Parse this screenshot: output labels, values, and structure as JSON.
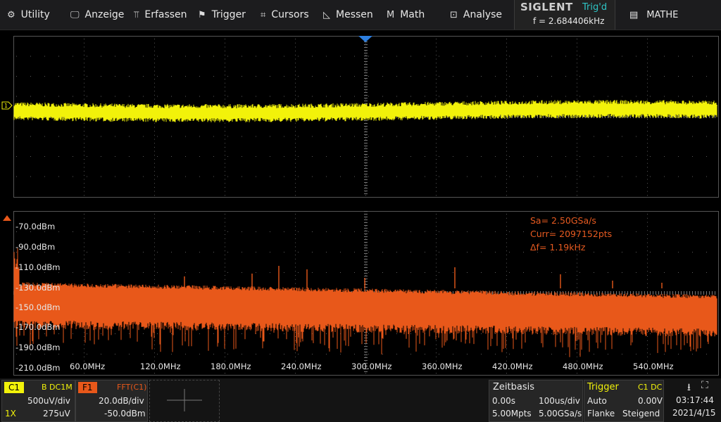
{
  "menu": {
    "items": [
      {
        "label": "Utility",
        "icon": "gear-icon"
      },
      {
        "label": "Anzeige",
        "icon": "monitor-icon"
      },
      {
        "label": "Erfassen",
        "icon": "acquire-icon"
      },
      {
        "label": "Trigger",
        "icon": "flag-icon"
      },
      {
        "label": "Cursors",
        "icon": "crosshair-icon"
      },
      {
        "label": "Messen",
        "icon": "measure-icon"
      },
      {
        "label": "Math",
        "icon": "math-icon"
      },
      {
        "label": "Analyse",
        "icon": "analyse-icon"
      }
    ],
    "brand": "SIGLENT",
    "trig_state": "Trig'd",
    "frequency": "f = 2.684406kHz",
    "mathe_label": "MATHE"
  },
  "fft": {
    "db_labels": [
      "-70.0dBm",
      "-90.0dBm",
      "-110.0dBm",
      "-130.0dBm",
      "-150.0dBm",
      "-170.0dBm",
      "-190.0dBm",
      "-210.0dBm"
    ],
    "freq_labels": [
      "60.0MHz",
      "120.0MHz",
      "180.0MHz",
      "240.0MHz",
      "300.0MHz",
      "360.0MHz",
      "420.0MHz",
      "480.0MHz",
      "540.0MHz"
    ],
    "info": {
      "sa": "Sa=  2.50GSa/s",
      "curr": "Curr= 2097152pts",
      "df": "Δf=  1.19kHz"
    }
  },
  "colors": {
    "ch1": "#f2f20a",
    "fft": "#e8581a",
    "trig": "#2ec4c4",
    "grid": "#5a5a5a"
  },
  "status": {
    "c1": {
      "tag": "C1",
      "coupling": "B DC1M",
      "vdiv": "500uV/div",
      "probe": "1X",
      "offset": "275uV"
    },
    "f1": {
      "tag": "F1",
      "source": "FFT(C1)",
      "scale": "20.0dB/div",
      "ref": "-50.0dBm"
    },
    "timebase": {
      "title": "Zeitbasis",
      "delay": "0.00s",
      "tdiv": "100us/div",
      "mpts": "5.00Mpts",
      "rate": "5.00GSa/s"
    },
    "trigger": {
      "title": "Trigger",
      "src": "C1 DC",
      "mode": "Auto",
      "level": "0.00V",
      "type": "Flanke",
      "slope": "Steigend"
    },
    "clock": {
      "time": "03:17:44",
      "date": "2021/4/15"
    }
  }
}
